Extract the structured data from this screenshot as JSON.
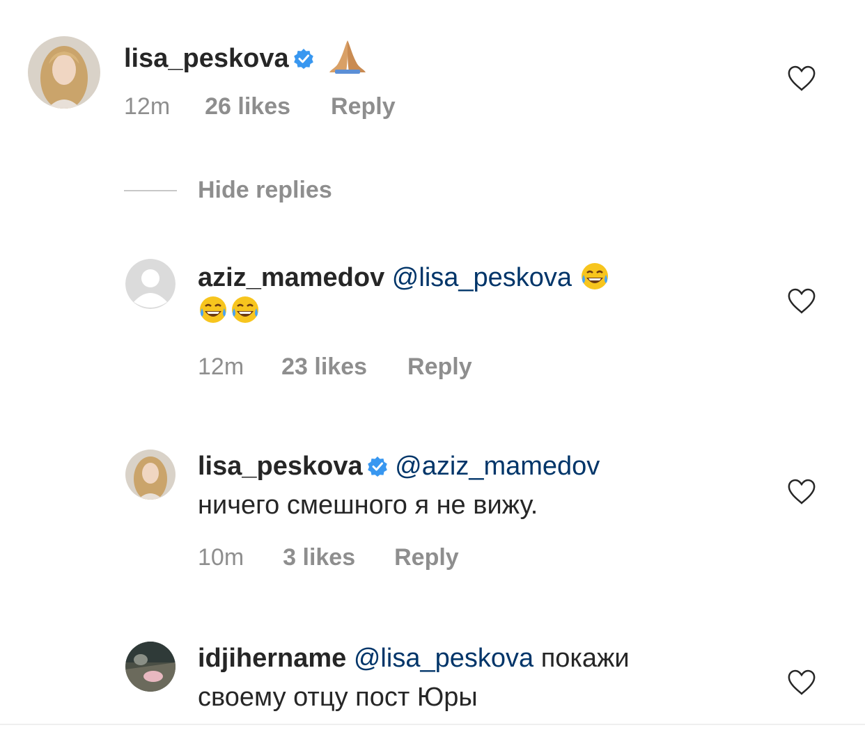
{
  "comments": [
    {
      "username": "lisa_peskova",
      "verified": true,
      "text_line1": "",
      "emoji": "folded-hands",
      "time": "12m",
      "likes": "26 likes",
      "reply": "Reply"
    },
    {
      "username": "aziz_mamedov",
      "mention": "@lisa_peskova",
      "emoji": "tears-of-joy x3",
      "time": "12m",
      "likes": "23 likes",
      "reply": "Reply"
    },
    {
      "username": "lisa_peskova",
      "verified": true,
      "mention": "@aziz_mamedov",
      "text_line2": "ничего смешного я не вижу.",
      "time": "10m",
      "likes": "3 likes",
      "reply": "Reply"
    },
    {
      "username": "idjihername",
      "mention": "@lisa_peskova",
      "text_line1": "покажи",
      "text_line2": "своему отцу пост Юры"
    }
  ],
  "hide_replies": "Hide replies",
  "colors": {
    "text": "#262626",
    "meta": "#8e8e8e",
    "mention": "#003569",
    "verified_blue": "#3897f0"
  },
  "icons": [
    "heart-outline-icon",
    "verified-badge-icon",
    "folded-hands-emoji",
    "tears-of-joy-emoji",
    "default-avatar-icon"
  ]
}
